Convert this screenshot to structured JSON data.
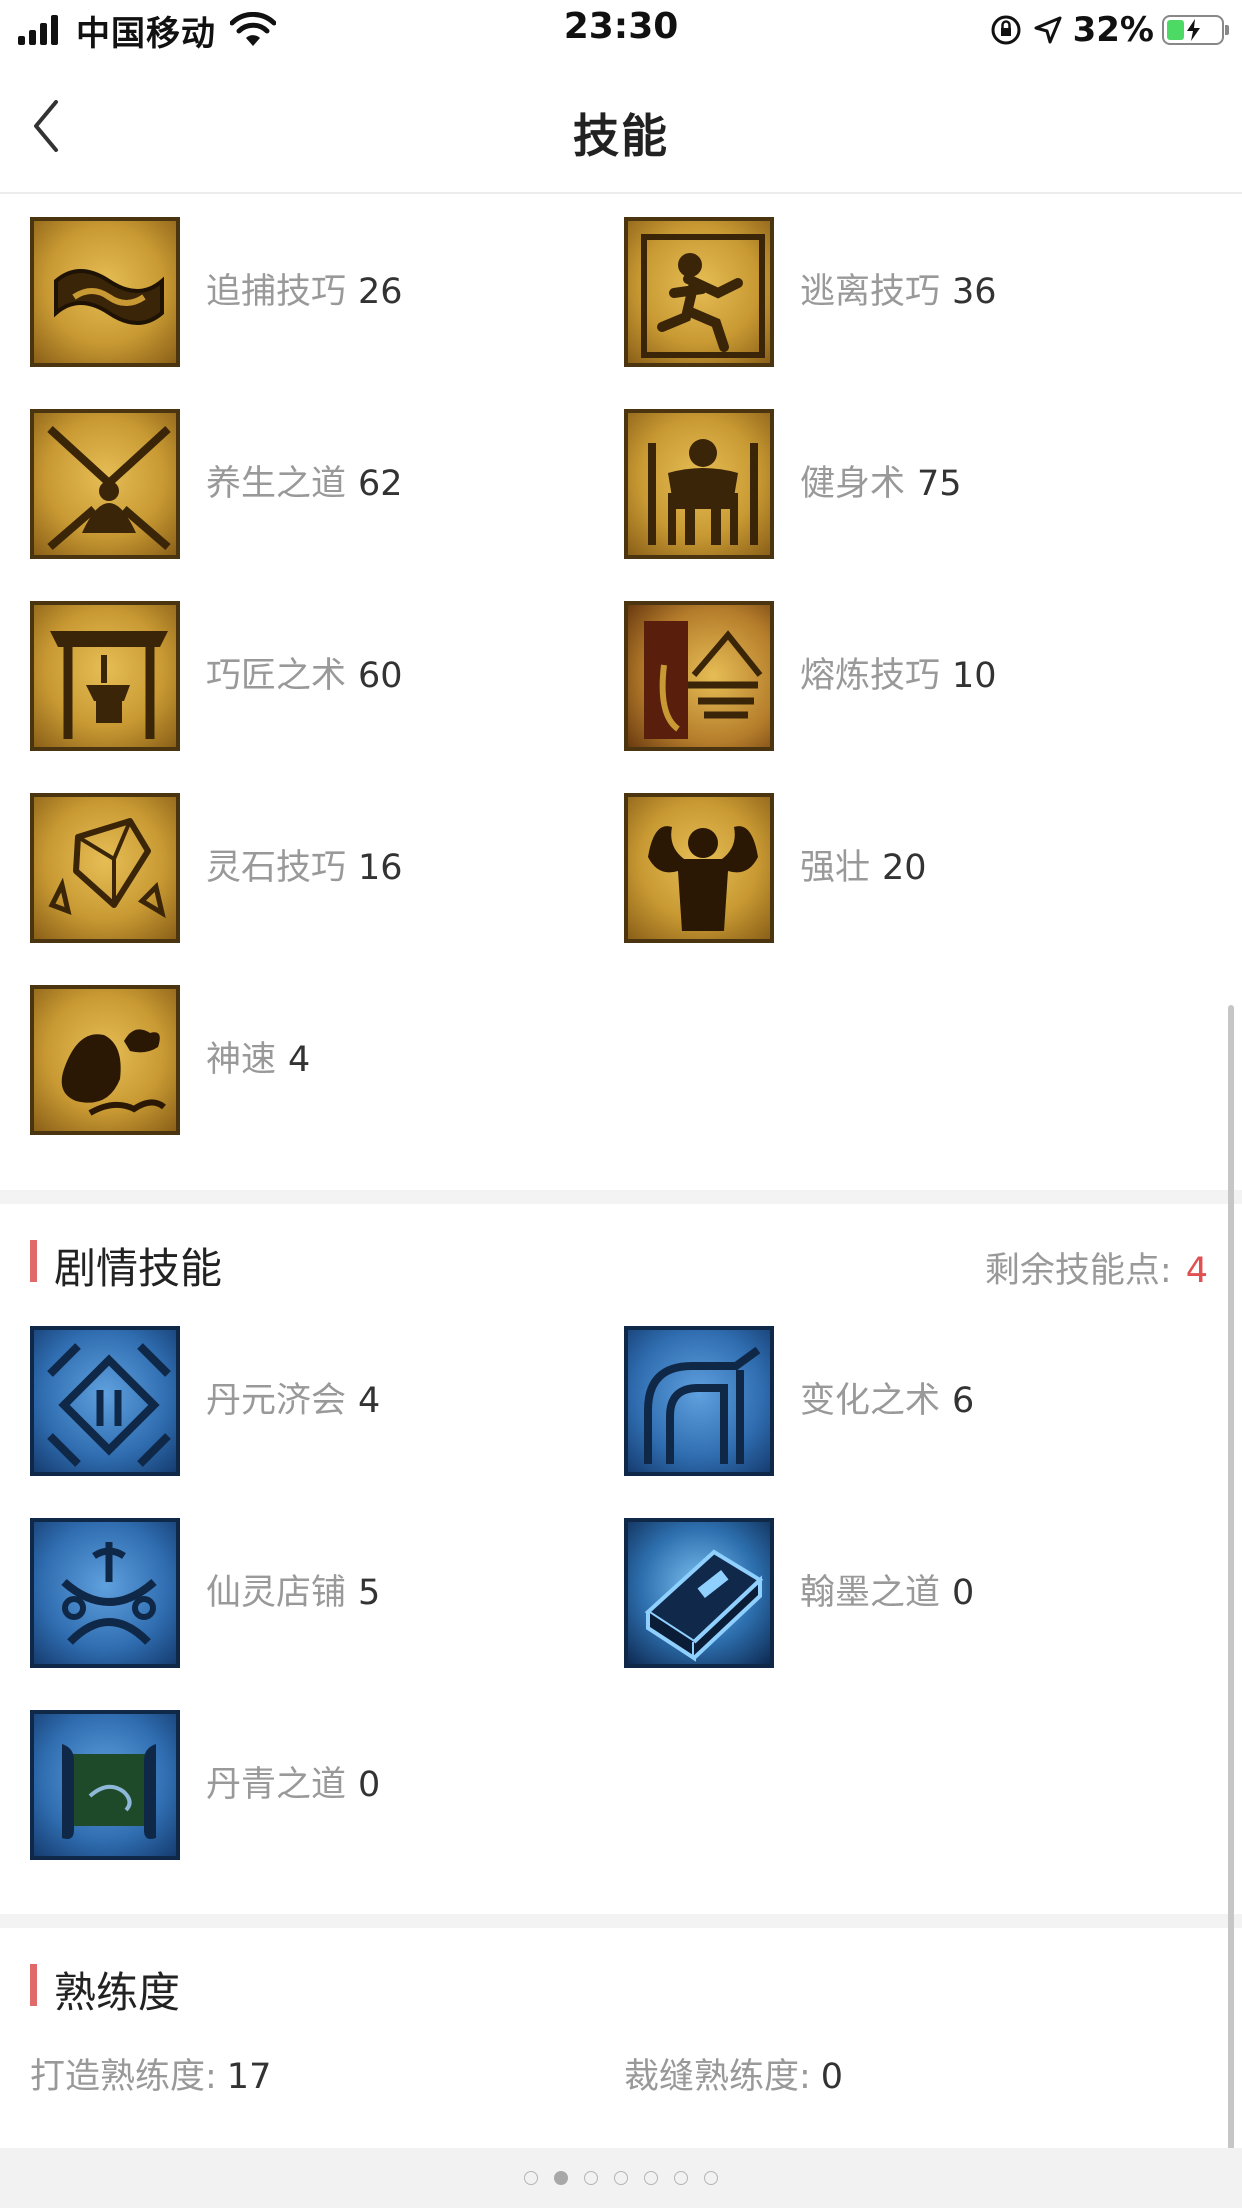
{
  "status_bar": {
    "carrier": "中国移动",
    "time": "23:30",
    "battery": "32%",
    "battery_level": 0.32,
    "battery_color": "#4cd964"
  },
  "nav": {
    "title": "技能",
    "back_icon": "chevron-left-icon"
  },
  "skills": [
    {
      "name": "追捕技巧",
      "level": "26",
      "icon": "chain-icon"
    },
    {
      "name": "逃离技巧",
      "level": "36",
      "icon": "running-figure-icon"
    },
    {
      "name": "养生之道",
      "level": "62",
      "icon": "meditation-icon"
    },
    {
      "name": "健身术",
      "level": "75",
      "icon": "body-icon"
    },
    {
      "name": "巧匠之术",
      "level": "60",
      "icon": "anvil-icon"
    },
    {
      "name": "熔炼技巧",
      "level": "10",
      "icon": "furnace-icon"
    },
    {
      "name": "灵石技巧",
      "level": "16",
      "icon": "gem-icon"
    },
    {
      "name": "强壮",
      "level": "20",
      "icon": "strongman-icon"
    },
    {
      "name": "神速",
      "level": "4",
      "icon": "cloud-icon"
    }
  ],
  "story_skills": {
    "title": "剧情技能",
    "points_label": "剩余技能点:",
    "points_value": "4",
    "items": [
      {
        "name": "丹元济会",
        "level": "4",
        "icon": "pattern-icon"
      },
      {
        "name": "变化之术",
        "level": "6",
        "icon": "transform-icon"
      },
      {
        "name": "仙灵店铺",
        "level": "5",
        "icon": "shop-icon"
      },
      {
        "name": "翰墨之道",
        "level": "0",
        "icon": "book-icon"
      },
      {
        "name": "丹青之道",
        "level": "0",
        "icon": "scroll-icon"
      }
    ]
  },
  "proficiency": {
    "title": "熟练度",
    "items": [
      {
        "label": "打造熟练度:",
        "value": "17"
      },
      {
        "label": "裁缝熟练度:",
        "value": "0"
      }
    ]
  },
  "pagination": {
    "count": 7,
    "active": 2
  },
  "colors": {
    "accent": "#e06a6a",
    "points_value": "#e05050",
    "label_gray": "#999999"
  }
}
